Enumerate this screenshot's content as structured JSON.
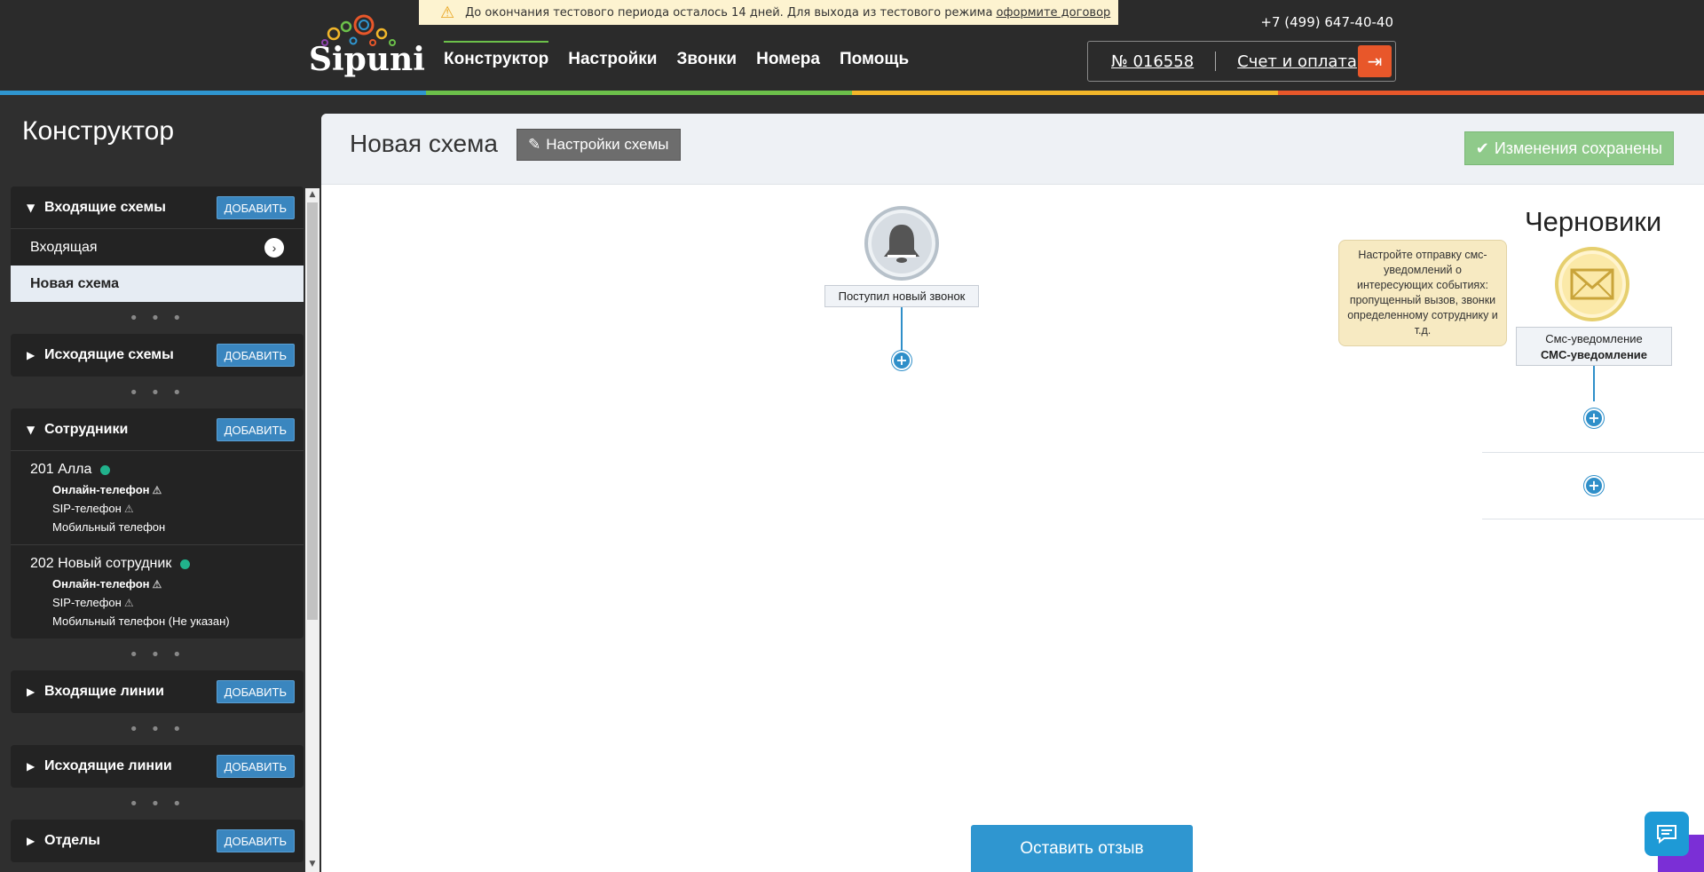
{
  "trial_banner": {
    "text": "До окончания тестового периода осталось 14 дней. Для выхода из тестового режима",
    "link": "оформите договор"
  },
  "logo": {
    "text": "Sipuni"
  },
  "nav": [
    {
      "label": "Конструктор"
    },
    {
      "label": "Настройки"
    },
    {
      "label": "Звонки"
    },
    {
      "label": "Номера"
    },
    {
      "label": "Помощь"
    }
  ],
  "account": {
    "phone": "+7 (499) 647-40-40",
    "number": "№ 016558",
    "billing": "Счет и оплата"
  },
  "sidebar": {
    "title": "Конструктор",
    "add_label": "ДОБАВИТЬ",
    "dots": "• • •",
    "incoming": {
      "title": "Входящие схемы",
      "items": [
        "Входящая",
        "Новая схема"
      ]
    },
    "outgoing": {
      "title": "Исходящие схемы"
    },
    "employees": {
      "title": "Сотрудники",
      "list": [
        {
          "name": "201 Алла",
          "devices": [
            "Онлайн-телефон",
            "SIP-телефон",
            "Мобильный телефон"
          ]
        },
        {
          "name": "202 Новый сотрудник",
          "devices": [
            "Онлайн-телефон",
            "SIP-телефон",
            "Мобильный телефон (Не указан)"
          ]
        }
      ]
    },
    "incoming_lines": {
      "title": "Входящие линии"
    },
    "outgoing_lines": {
      "title": "Исходящие линии"
    },
    "departments": {
      "title": "Отделы"
    }
  },
  "main": {
    "scheme_title": "Новая схема",
    "settings_button": "Настройки схемы",
    "saved_button": "Изменения сохранены",
    "start_node": "Поступил новый звонок",
    "drafts_title": "Черновики",
    "tip": "Настройте отправку смс-уведомлений о интересующих событиях: пропущенный вызов, звонки определенному сотруднику и т.д.",
    "sms_node_type": "Смс-уведомление",
    "sms_node_name": "СМС-уведомление"
  },
  "feedback_button": "Оставить отзыв",
  "colors": {
    "accent_blue": "#2f96d0",
    "rainbow": [
      "#2f96d0",
      "#6cc04a",
      "#f2b62a",
      "#e8572a"
    ]
  }
}
